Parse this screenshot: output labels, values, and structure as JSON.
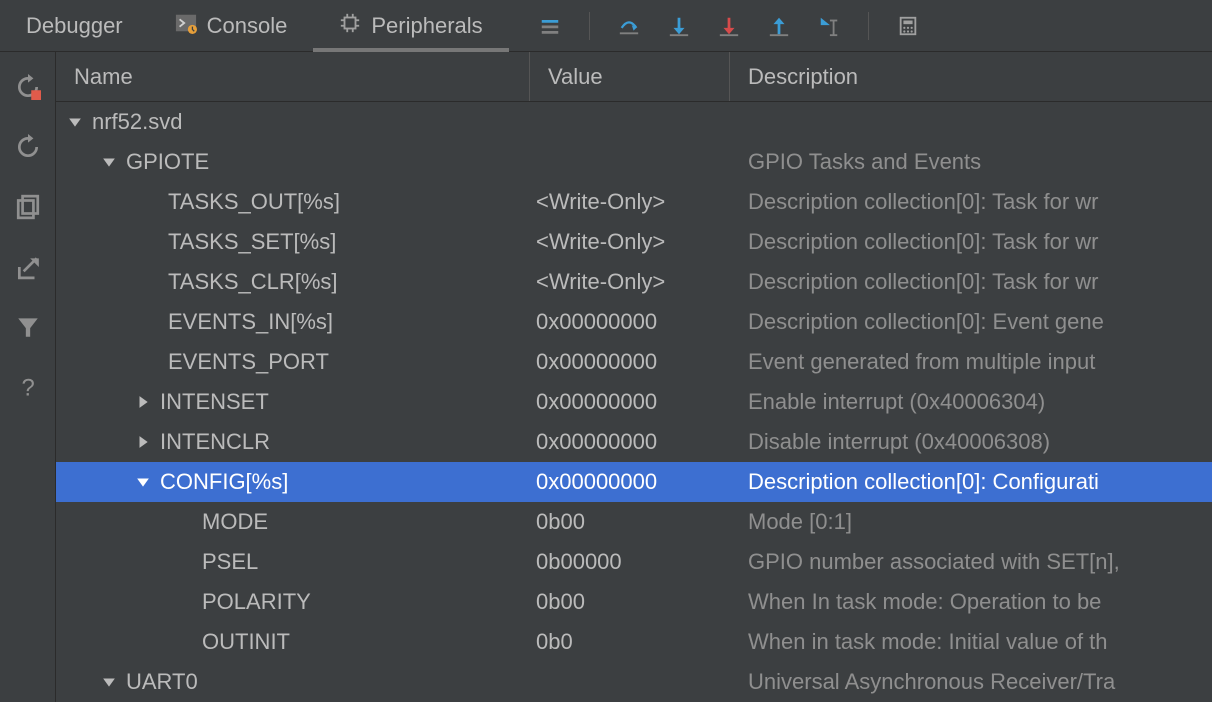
{
  "tabs": {
    "debugger": "Debugger",
    "console": "Console",
    "peripherals": "Peripherals"
  },
  "columns": {
    "name": "Name",
    "value": "Value",
    "description": "Description"
  },
  "tree": {
    "root": {
      "name": "nrf52.svd"
    },
    "gpiote": {
      "name": "GPIOTE",
      "desc": "GPIO Tasks and Events",
      "rows": [
        {
          "name": "TASKS_OUT[%s]",
          "value": "<Write-Only>",
          "desc": "Description collection[0]: Task for wr"
        },
        {
          "name": "TASKS_SET[%s]",
          "value": "<Write-Only>",
          "desc": "Description collection[0]: Task for wr"
        },
        {
          "name": "TASKS_CLR[%s]",
          "value": "<Write-Only>",
          "desc": "Description collection[0]: Task for wr"
        },
        {
          "name": "EVENTS_IN[%s]",
          "value": "0x00000000",
          "desc": "Description collection[0]: Event gene"
        },
        {
          "name": "EVENTS_PORT",
          "value": "0x00000000",
          "desc": "Event generated from multiple input "
        },
        {
          "name": "INTENSET",
          "value": "0x00000000",
          "desc": "Enable interrupt (0x40006304)"
        },
        {
          "name": "INTENCLR",
          "value": "0x00000000",
          "desc": "Disable interrupt (0x40006308)"
        }
      ],
      "config": {
        "name": "CONFIG[%s]",
        "value": "0x00000000",
        "desc": "Description collection[0]: Configurati",
        "fields": [
          {
            "name": "MODE",
            "value": "0b00",
            "desc": "Mode [0:1]"
          },
          {
            "name": "PSEL",
            "value": "0b00000",
            "desc": "GPIO number associated with SET[n],"
          },
          {
            "name": "POLARITY",
            "value": "0b00",
            "desc": "When In task mode: Operation to be "
          },
          {
            "name": "OUTINIT",
            "value": "0b0",
            "desc": "When in task mode: Initial value of th"
          }
        ]
      }
    },
    "uart0": {
      "name": "UART0",
      "desc": "Universal Asynchronous Receiver/Tra"
    }
  }
}
